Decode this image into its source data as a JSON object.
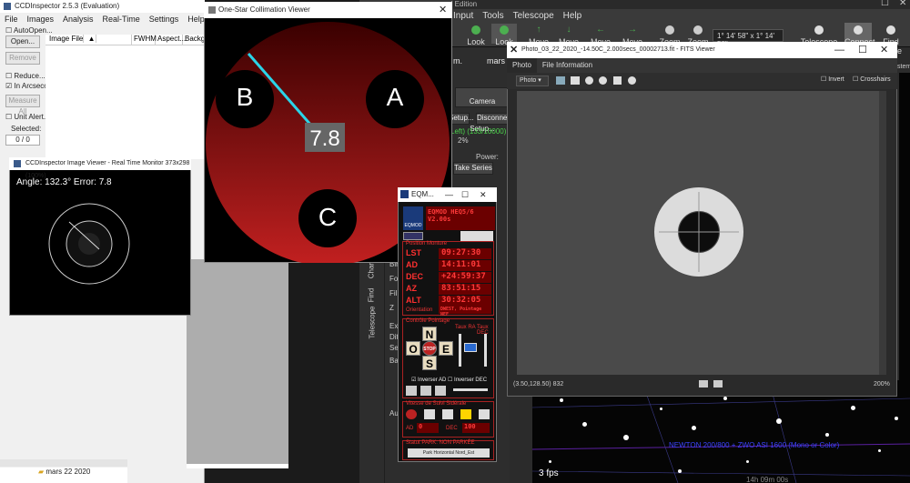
{
  "ccdinspector": {
    "title": "CCDInspector 2.5.3 (Evaluation)",
    "menu": [
      "File",
      "Images",
      "Analysis",
      "Real-Time",
      "Settings",
      "Help"
    ],
    "auto_open": "AutoOpen...",
    "open_button": "Open...",
    "remove_button": "Remove",
    "reduce": "Reduce...",
    "in_arcsec": "In Arcseco",
    "measure_all": "Measure All",
    "unit_alert": "Unit Alert...",
    "selected_label": "Selected:",
    "selected_value": "0 / 0",
    "columns": [
      "Image File",
      "FWHM",
      "Aspect...",
      "Backgr"
    ],
    "tree_item": "mars 22 2020"
  },
  "image_viewer": {
    "title": "CCDInspector Image Viewer - Real Time Monitor 373x298 (100%)",
    "readout": "Angle: 132.3° Error: 7.8"
  },
  "collimation": {
    "title": "One-Star Collimation Viewer",
    "label_a": "A",
    "label_b": "B",
    "label_c": "C",
    "error_value": "7.8"
  },
  "sky_app": {
    "title_suffix": "d Edition",
    "menu": [
      "Input",
      "Tools",
      "Telescope",
      "Help"
    ],
    "toolbar": [
      {
        "label": "th"
      },
      {
        "label": "Look West"
      },
      {
        "label": "Look Up"
      },
      {
        "label": "Move Up"
      },
      {
        "label": "Move Down"
      },
      {
        "label": "Move Left"
      },
      {
        "label": "Move Right"
      },
      {
        "label": "Zoom In"
      },
      {
        "label": "Zoom Out"
      },
      {
        "label": "Telescope Setup"
      },
      {
        "label": "Connect"
      },
      {
        "label": "Find Home"
      }
    ],
    "fov": "1° 14' 58\" x 1° 14' 58\"",
    "fps": "3 fps",
    "newton": "NEWTON 200/800 + ZWO ASI 1600 (Mono or Color)",
    "coords": "14h 09m 00s",
    "stem": "stem",
    "panel": {
      "m_label": "m.",
      "mars_label": "mars",
      "camera_setup": "Camera Setup...",
      "setup": "Setup...",
      "disconnect": "Disconnect",
      "left_count": "Left) (133/10000)",
      "percent": "2%",
      "power": "Power: 41.0",
      "take_series": "Take Series",
      "tabs_vertical": [
        "Chart",
        "Find",
        "Telescope"
      ],
      "short_labels": [
        "Bin",
        "Fo",
        "Fil",
        "Z",
        "Exp",
        "Dith",
        "Seri",
        "Bas",
        "Au"
      ]
    }
  },
  "fits_viewer": {
    "title": "Photo_03_22_2020_-14.50C_2.000secs_00002713.fit - FITS Viewer",
    "tabs": [
      "Photo",
      "File Information"
    ],
    "mode": "Photo",
    "invert": "Invert",
    "crosshairs": "Crosshairs",
    "status": "(3.50,128.50) 832",
    "zoom": "200%"
  },
  "eqmod": {
    "title": "EQM...",
    "logo_text": "EQMOD",
    "mount": "EQMOD HEQ5/6",
    "rate": "V2.00s",
    "position_title": "Position Monture",
    "rows": [
      {
        "label": "LST",
        "value": "09:27:30"
      },
      {
        "label": "AD",
        "value": "14:11:01"
      },
      {
        "label": "DEC",
        "value": "+24:59:37"
      },
      {
        "label": "AZ",
        "value": "83:51:15"
      },
      {
        "label": "ALT",
        "value": "30:32:05"
      }
    ],
    "orientation_label": "Orientation",
    "orientation_value": "DWEST, Pointage NEF",
    "control_title": "Contrôle Pointage",
    "taux_ra": "Taux RA",
    "taux_dec": "Taux DEC",
    "north": "N",
    "south": "S",
    "east": "E",
    "west": "O",
    "stop": "STOP",
    "inverser_ad": "Inverser AD",
    "inverser_dec": "Inverser DEC",
    "speed_title": "Vitesse de Suivi Sidérale",
    "ad_label": "AD",
    "ad_value": "0",
    "dec_label": "DEC",
    "dec_value": "100",
    "park_title": "Statut PARK: NON PARKÉE",
    "park_button": "Park Horizontal Nord_Est"
  }
}
